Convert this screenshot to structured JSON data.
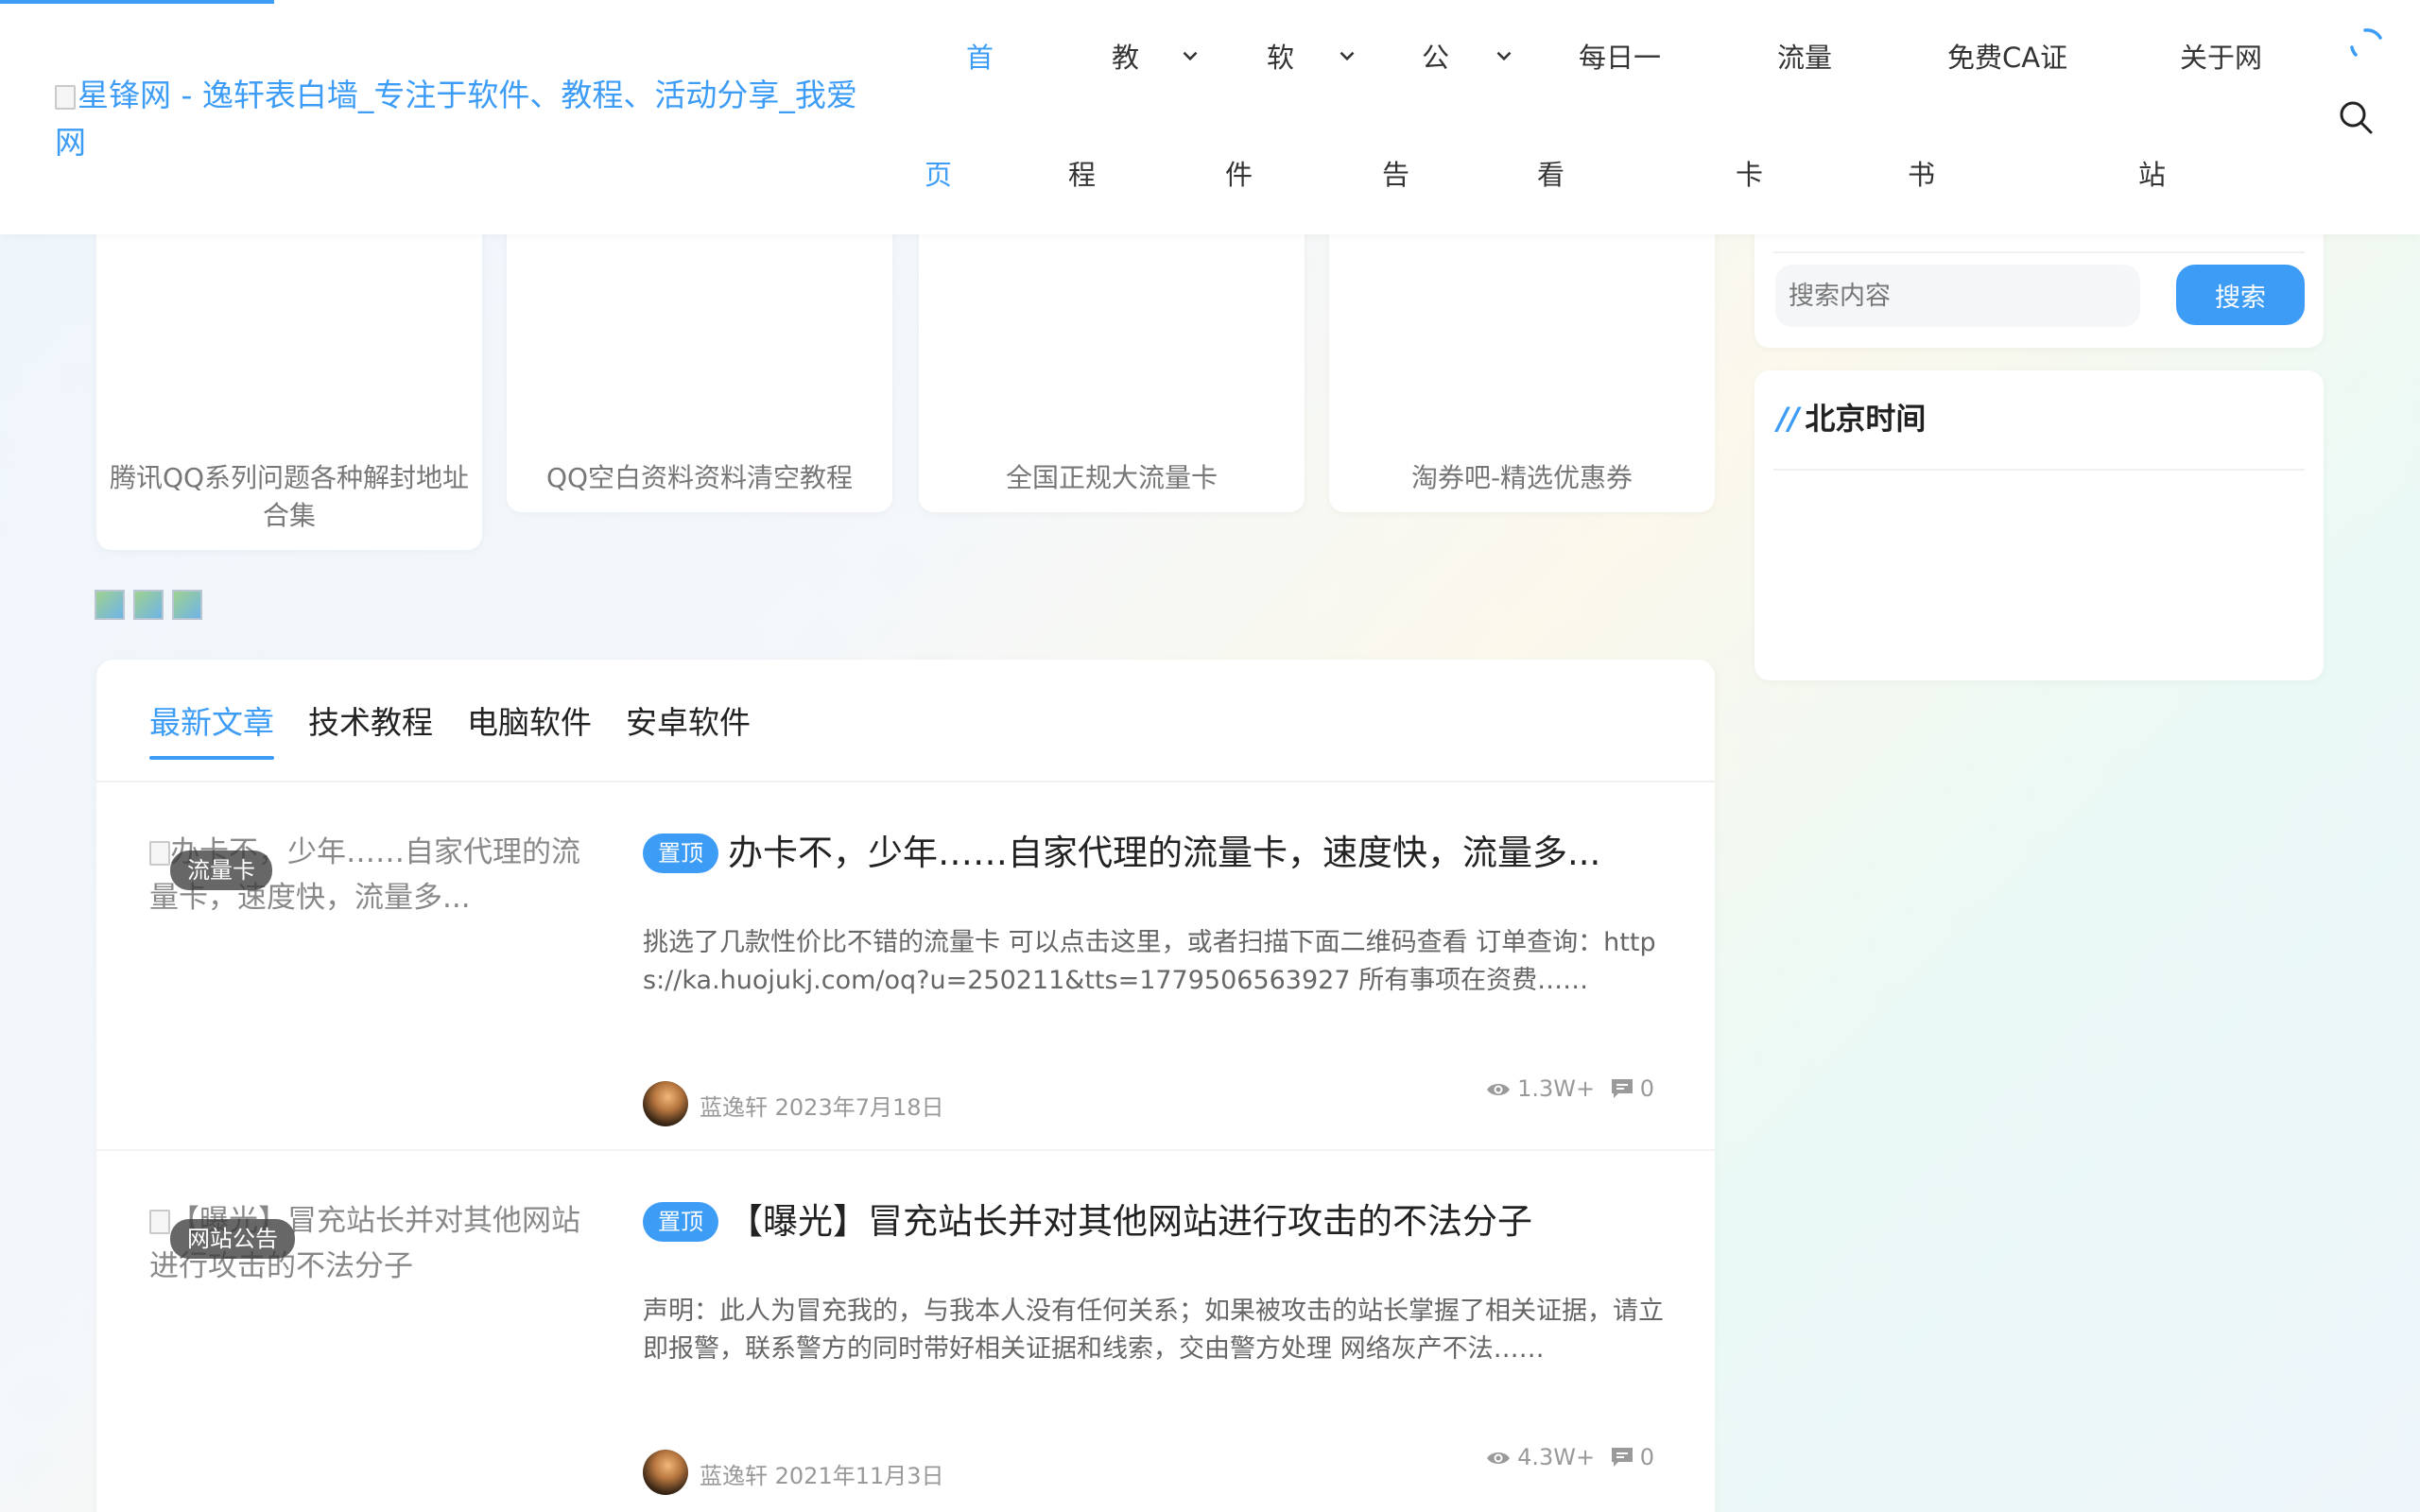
{
  "header": {
    "logo_alt": "星锋网 - 逸轩表白墙_专注于软件、教程、活动分享_我爱网",
    "nav": [
      {
        "top": "首",
        "bottom": "页",
        "active": true,
        "dropdown": false
      },
      {
        "top": "教",
        "bottom": "程",
        "active": false,
        "dropdown": true
      },
      {
        "top": "软",
        "bottom": "件",
        "active": false,
        "dropdown": true
      },
      {
        "top": "公",
        "bottom": "告",
        "active": false,
        "dropdown": true
      },
      {
        "top": "每日一",
        "bottom": "看",
        "active": false,
        "dropdown": false
      },
      {
        "top": "流量",
        "bottom": "卡",
        "active": false,
        "dropdown": false
      },
      {
        "top": "免费CA证",
        "bottom": "书",
        "active": false,
        "dropdown": false
      },
      {
        "top": "关于网",
        "bottom": "站",
        "active": false,
        "dropdown": false
      }
    ],
    "icons": {
      "loader": "loading-spinner-icon",
      "search": "search-icon"
    }
  },
  "hot_cards": [
    {
      "title": "腾讯QQ系列问题各种解封地址合集"
    },
    {
      "title": "QQ空白资料资料清空教程"
    },
    {
      "title": "全国正规大流量卡"
    },
    {
      "title": "淘券吧-精选优惠券"
    }
  ],
  "tabs": [
    {
      "label": "最新文章",
      "active": true
    },
    {
      "label": "技术教程",
      "active": false
    },
    {
      "label": "电脑软件",
      "active": false
    },
    {
      "label": "安卓软件",
      "active": false
    }
  ],
  "posts": [
    {
      "image_alt": "办卡不，少年……自家代理的流量卡，速度快，流量多...",
      "category": "流量卡",
      "pin": "置顶",
      "title": "办卡不，少年……自家代理的流量卡，速度快，流量多...",
      "excerpt": "挑选了几款性价比不错的流量卡 可以点击这里，或者扫描下面二维码查看 订单查询：https://ka.huojukj.com/oq?u=250211&tts=1779506563927 所有事项在资费……",
      "author": "蓝逸轩",
      "date": "2023年7月18日",
      "views": "1.3W+",
      "comments": "0"
    },
    {
      "image_alt": "【曝光】冒充站长并对其他网站进行攻击的不法分子",
      "category": "网站公告",
      "pin": "置顶",
      "title": "【曝光】冒充站长并对其他网站进行攻击的不法分子",
      "excerpt": "声明：此人为冒充我的，与我本人没有任何关系；如果被攻击的站长掌握了相关证据，请立即报警，联系警方的同时带好相关证据和线索，交由警方处理 网络灰产不法……",
      "author": "蓝逸轩",
      "date": "2021年11月3日",
      "views": "4.3W+",
      "comments": "0"
    }
  ],
  "sidebar": {
    "search": {
      "placeholder": "搜索内容",
      "button": "搜索"
    },
    "time_widget": {
      "title": "北京时间",
      "title_prefix": "//"
    }
  },
  "colors": {
    "accent": "#3d9cf5",
    "text": "#333333",
    "muted": "#999999"
  }
}
